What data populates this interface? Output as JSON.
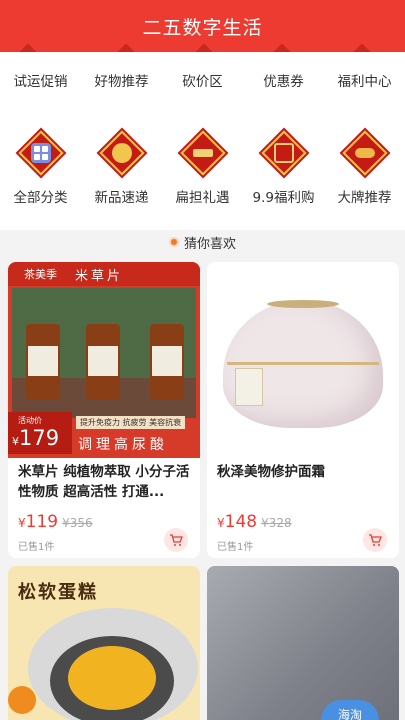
{
  "header": {
    "title": "二五数字生活"
  },
  "quick_links": [
    "试运促销",
    "好物推荐",
    "砍价区",
    "优惠券",
    "福利中心"
  ],
  "categories": [
    {
      "label": "全部分类",
      "icon": "grid-icon"
    },
    {
      "label": "新品速递",
      "icon": "new-arrival-icon"
    },
    {
      "label": "扁担礼遇",
      "icon": "gift-icon"
    },
    {
      "label": "9.9福利购",
      "icon": "coupon-icon"
    },
    {
      "label": "大牌推荐",
      "icon": "brand-icon"
    }
  ],
  "section": {
    "title": "猜你喜欢"
  },
  "products": [
    {
      "title": "米草片 纯植物萃取 小分子活性物质 超高活性 打通...",
      "price_symbol": "¥",
      "price": "119",
      "original_price": "¥356",
      "sold": "已售1件",
      "banner": {
        "brand": "茶美季",
        "name": "米草片",
        "promo_tag": "活动价",
        "promo_price": "179",
        "promo_symbol": "¥",
        "slogan": "调理高尿酸",
        "tags": "提升免疫力 抗疲劳 美容抗衰"
      }
    },
    {
      "title": "秋泽美物修护面霜",
      "price_symbol": "¥",
      "price": "148",
      "original_price": "¥328",
      "sold": "已售1件"
    },
    {
      "banner": {
        "headline": "松软蛋糕"
      }
    },
    {
      "badge": "海淘"
    }
  ]
}
